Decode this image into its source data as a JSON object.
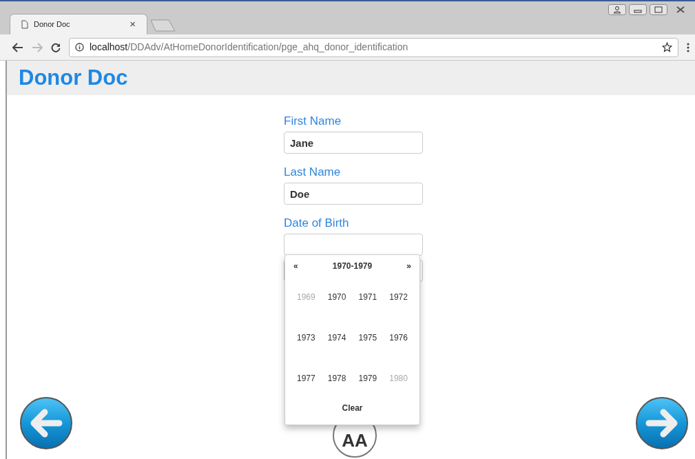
{
  "browser": {
    "tab_title": "Donor Doc",
    "tab_close": "×",
    "url_host": "localhost",
    "url_path": "/DDAdv/AtHomeDonorIdentification/pge_ahq_donor_identification"
  },
  "header": {
    "title": "Donor Doc"
  },
  "form": {
    "fields": [
      {
        "label": "First Name",
        "value": "Jane"
      },
      {
        "label": "Last Name",
        "value": "Doe"
      },
      {
        "label": "Date of Birth"
      }
    ]
  },
  "datepicker": {
    "prev": "«",
    "title": "1970-1979",
    "next": "»",
    "years": [
      {
        "label": "1969",
        "outside": true
      },
      {
        "label": "1970",
        "outside": false
      },
      {
        "label": "1971",
        "outside": false
      },
      {
        "label": "1972",
        "outside": false
      },
      {
        "label": "1973",
        "outside": false
      },
      {
        "label": "1974",
        "outside": false
      },
      {
        "label": "1975",
        "outside": false
      },
      {
        "label": "1976",
        "outside": false
      },
      {
        "label": "1977",
        "outside": false
      },
      {
        "label": "1978",
        "outside": false
      },
      {
        "label": "1979",
        "outside": false
      },
      {
        "label": "1980",
        "outside": true
      }
    ],
    "clear": "Clear"
  },
  "font_size_button": "AA"
}
